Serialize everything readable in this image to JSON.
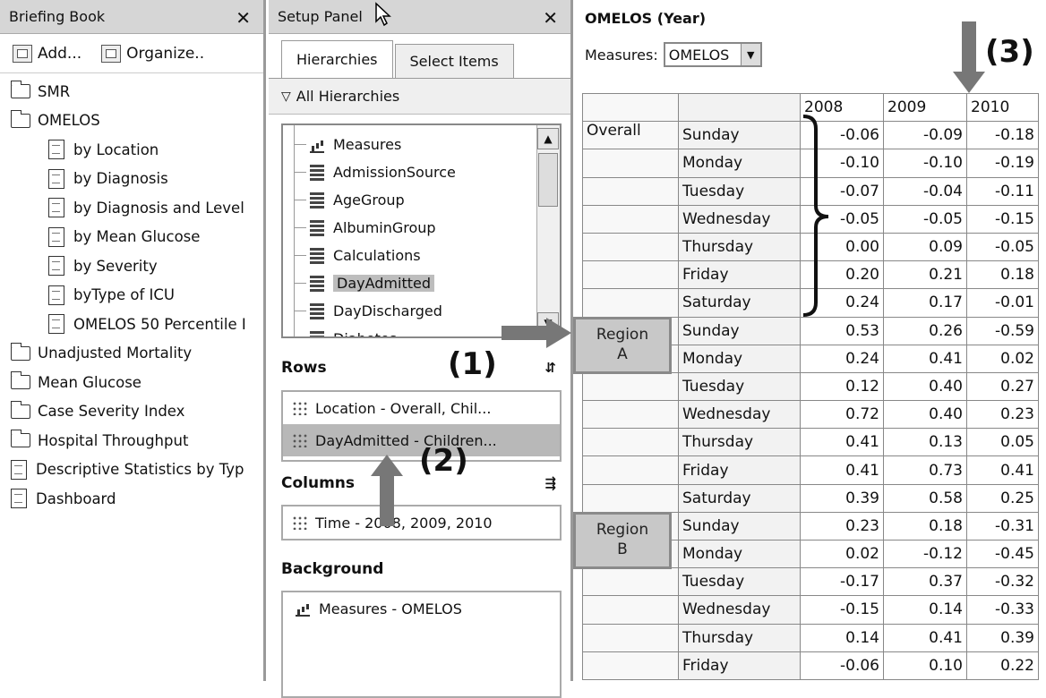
{
  "briefing_book": {
    "title": "Briefing Book",
    "close": "✕",
    "add_label": "Add...",
    "organize_label": "Organize..",
    "folders": {
      "smr": "SMR",
      "omelos": "OMELOS",
      "unadjusted": "Unadjusted Mortality",
      "glucose": "Mean Glucose",
      "severity": "Case Severity Index",
      "throughput": "Hospital Throughput"
    },
    "omelos_items": [
      "by Location",
      "by Diagnosis",
      "by Diagnosis and Level",
      "by Mean Glucose",
      "by Severity",
      "byType of ICU",
      "OMELOS 50 Percentile I"
    ],
    "docs": {
      "descriptive": "Descriptive Statistics by Typ",
      "dashboard": "Dashboard"
    }
  },
  "setup_panel": {
    "title": "Setup Panel",
    "close": "✕",
    "tabs": [
      "Hierarchies",
      "Select Items"
    ],
    "all_hierarchies": "All Hierarchies",
    "hierarchies": [
      "Measures",
      "AdmissionSource",
      "AgeGroup",
      "AlbuminGroup",
      "Calculations",
      "DayAdmitted",
      "DayDischarged",
      "Diabetes"
    ],
    "rows_label": "Rows",
    "rows": [
      "Location - Overall, Chil...",
      "DayAdmitted - Children..."
    ],
    "columns_label": "Columns",
    "columns": [
      "Time - 2008, 2009, 2010"
    ],
    "background_label": "Background",
    "background": [
      "Measures - OMELOS"
    ]
  },
  "table": {
    "title": "OMELOS (Year)",
    "measures_label": "Measures:",
    "measures_value": "OMELOS",
    "years": [
      "2008",
      "2009",
      "2010"
    ],
    "group_overall": "Overall",
    "rows": [
      {
        "day": "Sunday",
        "v": [
          "-0.06",
          "-0.09",
          "-0.18"
        ]
      },
      {
        "day": "Monday",
        "v": [
          "-0.10",
          "-0.10",
          "-0.19"
        ]
      },
      {
        "day": "Tuesday",
        "v": [
          "-0.07",
          "-0.04",
          "-0.11"
        ]
      },
      {
        "day": "Wednesday",
        "v": [
          "-0.05",
          "-0.05",
          "-0.15"
        ]
      },
      {
        "day": "Thursday",
        "v": [
          "0.00",
          "0.09",
          "-0.05"
        ]
      },
      {
        "day": "Friday",
        "v": [
          "0.20",
          "0.21",
          "0.18"
        ]
      },
      {
        "day": "Saturday",
        "v": [
          "0.24",
          "0.17",
          "-0.01"
        ]
      },
      {
        "day": "Sunday",
        "v": [
          "0.53",
          "0.26",
          "-0.59"
        ]
      },
      {
        "day": "Monday",
        "v": [
          "0.24",
          "0.41",
          "0.02"
        ]
      },
      {
        "day": "Tuesday",
        "v": [
          "0.12",
          "0.40",
          "0.27"
        ]
      },
      {
        "day": "Wednesday",
        "v": [
          "0.72",
          "0.40",
          "0.23"
        ]
      },
      {
        "day": "Thursday",
        "v": [
          "0.41",
          "0.13",
          "0.05"
        ]
      },
      {
        "day": "Friday",
        "v": [
          "0.41",
          "0.73",
          "0.41"
        ]
      },
      {
        "day": "Saturday",
        "v": [
          "0.39",
          "0.58",
          "0.25"
        ]
      },
      {
        "day": "Sunday",
        "v": [
          "0.23",
          "0.18",
          "-0.31"
        ]
      },
      {
        "day": "Monday",
        "v": [
          "0.02",
          "-0.12",
          "-0.45"
        ]
      },
      {
        "day": "Tuesday",
        "v": [
          "-0.17",
          "0.37",
          "-0.32"
        ]
      },
      {
        "day": "Wednesday",
        "v": [
          "-0.15",
          "0.14",
          "-0.33"
        ]
      },
      {
        "day": "Thursday",
        "v": [
          "0.14",
          "0.41",
          "0.39"
        ]
      },
      {
        "day": "Friday",
        "v": [
          "-0.06",
          "0.10",
          "0.22"
        ]
      }
    ]
  },
  "annotations": {
    "a1": "(1)",
    "a2": "(2)",
    "a3": "(3)",
    "region_a": [
      "Region",
      "A"
    ],
    "region_b": [
      "Region",
      "B"
    ]
  }
}
